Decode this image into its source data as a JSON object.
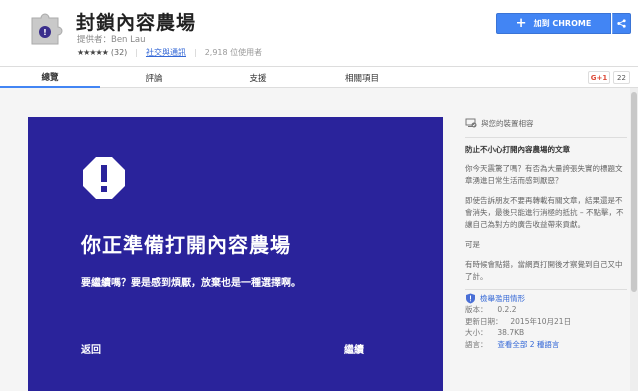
{
  "app": {
    "title": "封鎖內容農場",
    "provider_label": "提供者：Ben Lau",
    "stars": "★★★★★",
    "rating_count": "(32)",
    "category": "社交與通訊",
    "users": "2,918 位使用者",
    "add_button": "加到 CHROME",
    "brand_color": "#4285f4",
    "icon_names": [
      "puzzle-icon",
      "share-icon",
      "warning-icon",
      "report-icon",
      "compat-icon"
    ]
  },
  "tabs": [
    {
      "label": "總覽",
      "active": true
    },
    {
      "label": "評論",
      "active": false
    },
    {
      "label": "支援",
      "active": false
    },
    {
      "label": "相關項目",
      "active": false
    }
  ],
  "social": {
    "gplus": "G+1",
    "count": "22"
  },
  "promo": {
    "bg_color": "#2a239b",
    "title": "你正準備打開內容農場",
    "subtitle": "要繼續嗎？要是感到煩厭，放棄也是一種選擇啊。",
    "back": "返回",
    "continue": "繼續"
  },
  "sidebar": {
    "compat": "與您的裝置相容",
    "heading": "防止不小心打開內容農場的文章",
    "p1": "你今天震驚了嗎？有否為大量誇張失實的標題文章湧進日常生活而感到厭惡？",
    "p2": "即使告訴朋友不要再轉載有關文章，結果還是不會消失，最後只能進行消極的抵抗 – 不點擊，不讓自己為對方的廣告收益帶來貢獻。",
    "p3": "可是",
    "p4": "有時候會點錯，當網頁打開後才察覺到自己又中了計。",
    "report": "檢舉濫用情形",
    "version_label": "版本：",
    "version": "0.2.2",
    "updated_label": "更新日期：",
    "updated": "2015年10月21日",
    "size_label": "大小：",
    "size": "38.7KB",
    "lang_label": "語言：",
    "lang": "查看全部 2 種語言"
  }
}
